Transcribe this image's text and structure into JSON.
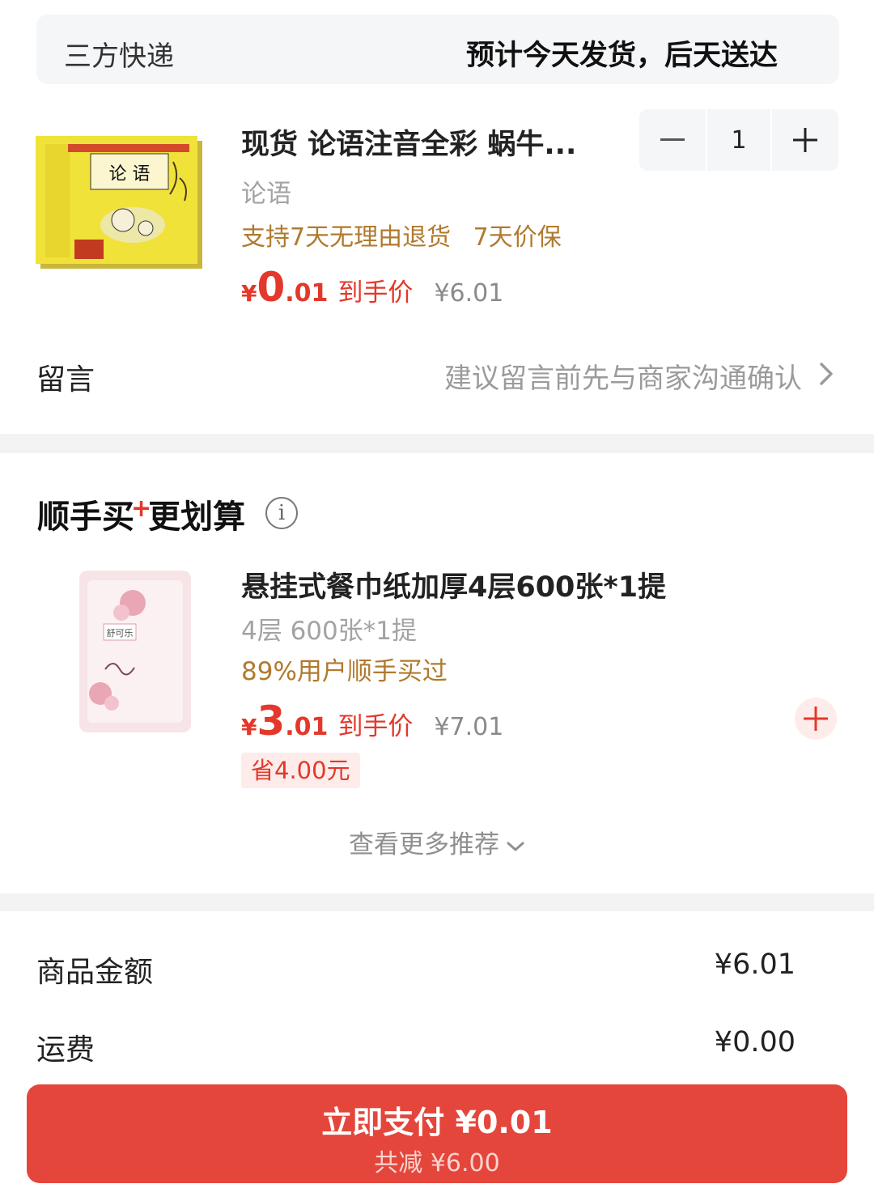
{
  "shipping": {
    "method": "三方快递",
    "eta": "预计今天发货，后天送达"
  },
  "product": {
    "title": "现货 论语注音全彩 蜗牛...",
    "spec": "论语",
    "tags": [
      "支持7天无理由退货",
      "7天价保"
    ],
    "price_symbol": "¥",
    "price_integer": "0",
    "price_decimal": ".01",
    "price_label": "到手价",
    "original_price": "¥6.01",
    "quantity": "1",
    "cover_title": "论 语"
  },
  "message": {
    "label": "留言",
    "hint": "建议留言前先与商家沟通确认"
  },
  "recommend": {
    "title_part1": "顺手买",
    "title_plus": "+",
    "title_part2": "更划算",
    "info_glyph": "i",
    "item": {
      "title": "悬挂式餐巾纸加厚4层600张*1提",
      "spec": "4层 600张*1提",
      "tag": "89%用户顺手买过",
      "price_symbol": "¥",
      "price_integer": "3",
      "price_decimal": ".01",
      "price_label": "到手价",
      "original_price": "¥7.01",
      "save": "省4.00元",
      "package_brand": "舒可乐"
    },
    "more": "查看更多推荐"
  },
  "summary": {
    "goods_label": "商品金额",
    "goods_value": "¥6.01",
    "shipping_label": "运费",
    "shipping_value": "¥0.00"
  },
  "pay": {
    "main": "立即支付 ¥0.01",
    "sub": "共减 ¥6.00"
  },
  "colors": {
    "accent": "#e3382b",
    "pay_button": "#e4463b",
    "tag_gold": "#b07a2e"
  }
}
